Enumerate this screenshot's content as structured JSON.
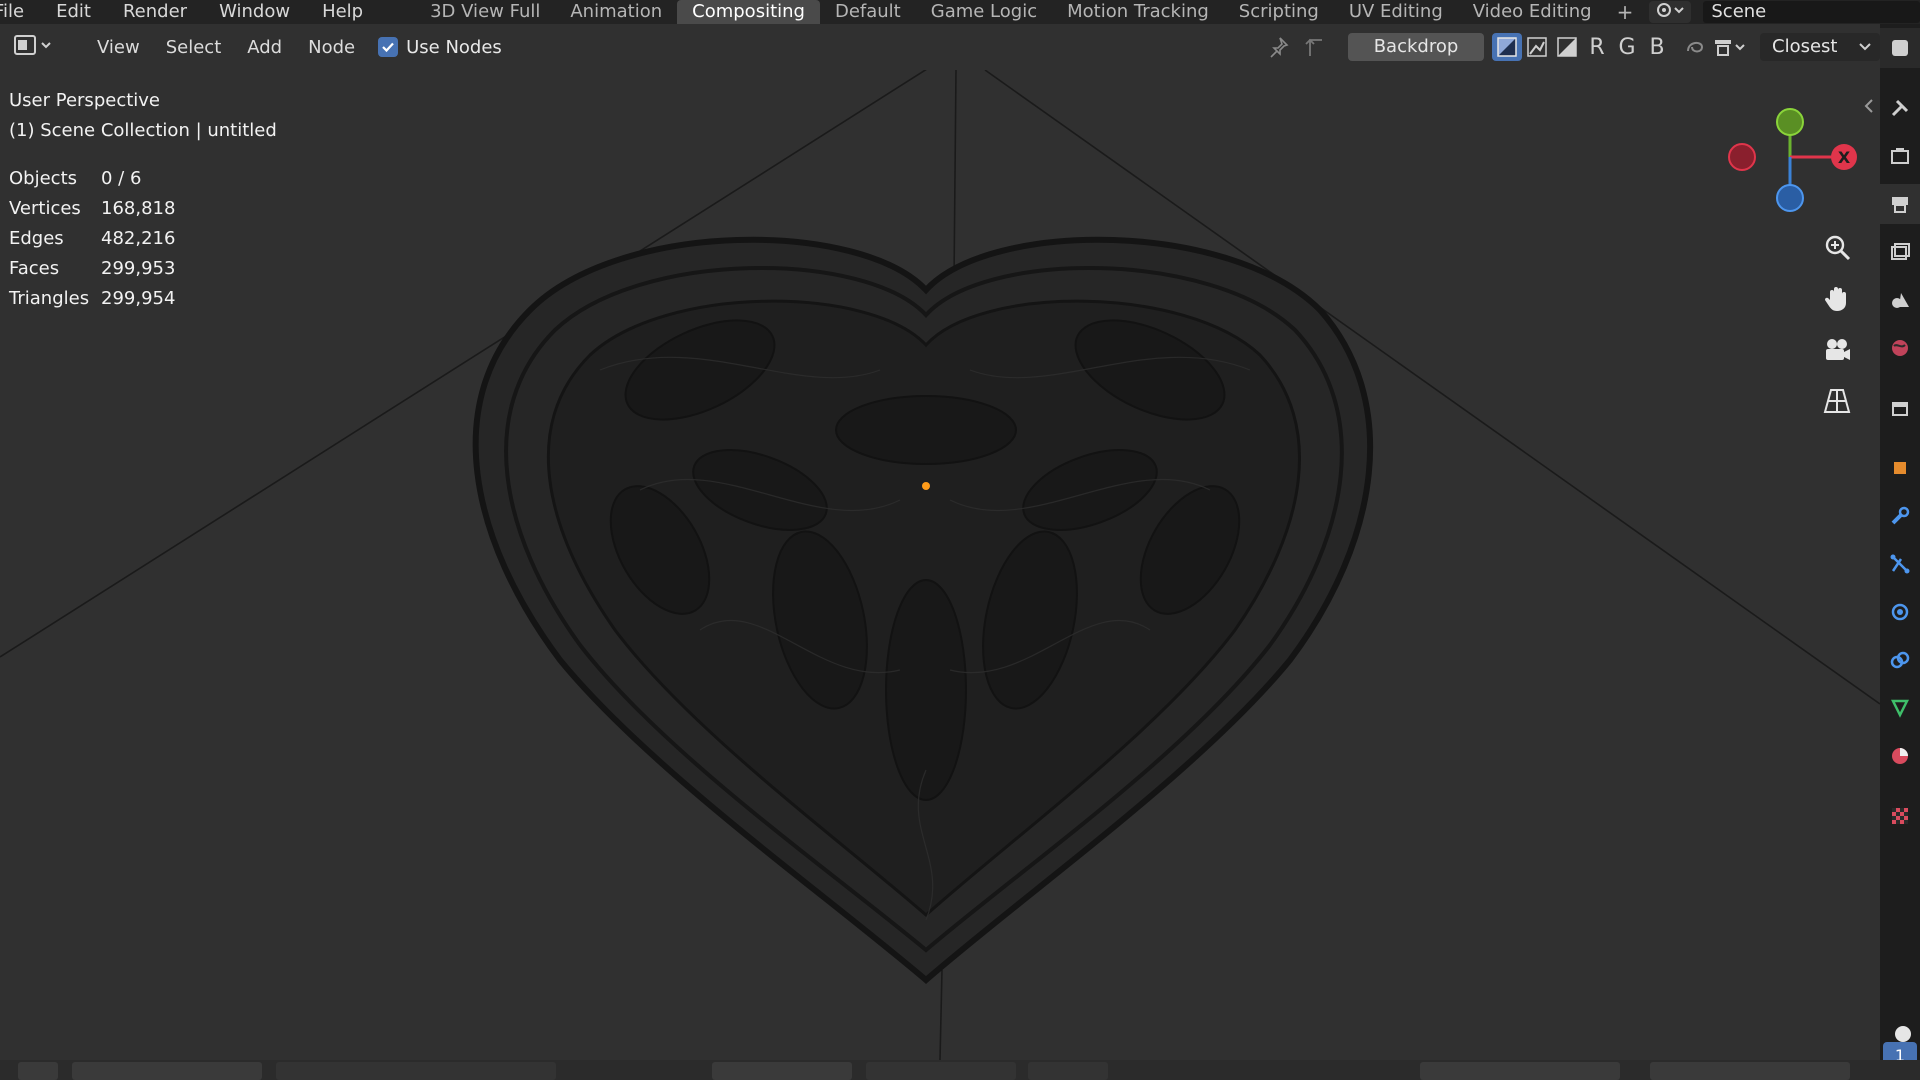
{
  "topbar": {
    "menus": [
      "File",
      "Edit",
      "Render",
      "Window",
      "Help"
    ],
    "workspaces": [
      "3D View Full",
      "Animation",
      "Compositing",
      "Default",
      "Game Logic",
      "Motion Tracking",
      "Scripting",
      "UV Editing",
      "Video Editing"
    ],
    "active_workspace": "Compositing",
    "add_tab": "+",
    "scene_name": "Scene"
  },
  "header": {
    "menus": [
      "View",
      "Select",
      "Add",
      "Node"
    ],
    "use_nodes_label": "Use Nodes",
    "use_nodes_checked": true,
    "backdrop_label": "Backdrop",
    "channel_r": "R",
    "channel_g": "G",
    "channel_b": "B",
    "filter_value": "Closest"
  },
  "viewport": {
    "view_name": "User Perspective",
    "collection": "(1) Scene Collection | untitled",
    "stats": [
      {
        "key": "Objects",
        "value": "0 / 6"
      },
      {
        "key": "Vertices",
        "value": "168,818"
      },
      {
        "key": "Edges",
        "value": "482,216"
      },
      {
        "key": "Faces",
        "value": "299,953"
      },
      {
        "key": "Triangles",
        "value": "299,954"
      }
    ],
    "gizmo_axis_label": "X"
  },
  "bottombar": {
    "frame_badge": "1"
  },
  "colors": {
    "accent": "#4772b3",
    "axis_x": "#e0354b",
    "axis_y": "#6bb32f",
    "axis_z": "#3b82d6",
    "origin": "#ff9c1a"
  }
}
